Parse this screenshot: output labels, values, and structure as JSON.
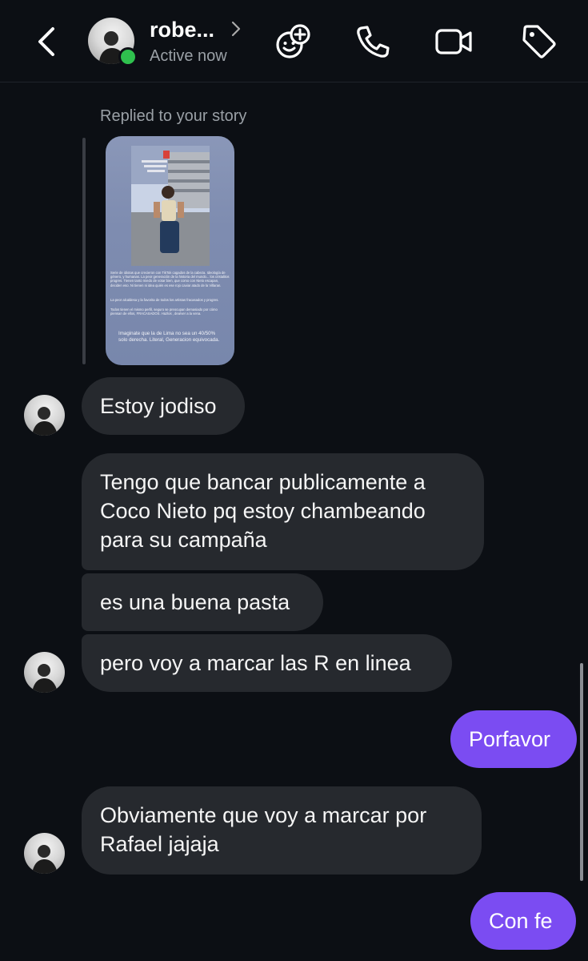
{
  "header": {
    "name": "robe...",
    "status": "Active now",
    "icons": [
      "back-arrow-icon",
      "chevron-right-icon",
      "sticker-add-icon",
      "phone-icon",
      "video-icon",
      "tag-icon"
    ]
  },
  "story_reply": {
    "label": "Replied to your story",
    "story_text_1": "Serie de idiotas que crecieron con TikTok cagados de la cabeza. Ideología de género, y humanas. La peor generación de la historia del mundo... los cristalitos progres. Tienen tanto miedo de votar bien, que como con Nieto escapan, deciden eso. Ni tienen ni idea quién es ese rojo caviar atado de la Villaran.",
    "story_text_2": "La peor alcaldesa y la favorita de todos los artistas fracasados y progres.",
    "story_text_3": "Todos tienen el mismo perfil, seguro se preocupan demasiado por cómo piensan de ellos, FRACASADOS. Hazlos , dea/ver a la vena.",
    "story_caption": "Imaginate que la de Lima no sea un 40/50% solo derecha. Literal, Generacion equivocada."
  },
  "messages": [
    {
      "direction": "in",
      "text": "Estoy jodiso"
    },
    {
      "direction": "in",
      "lines": [
        "Tengo que bancar publicamente a",
        "Coco Nieto pq estoy chambeando",
        "para su campaña"
      ]
    },
    {
      "direction": "in",
      "text": "es una buena pasta"
    },
    {
      "direction": "in",
      "text": "pero voy a marcar las R en linea"
    },
    {
      "direction": "out",
      "text": "Porfavor"
    },
    {
      "direction": "in",
      "lines": [
        "Obviamente que voy a marcar por",
        "Rafael jajaja"
      ]
    },
    {
      "direction": "out",
      "text": "Con fe"
    }
  ],
  "colors": {
    "background": "#0c0f14",
    "incoming_bubble": "#26292e",
    "outgoing_bubble": "#7b4cf2",
    "online": "#2fc14e"
  }
}
